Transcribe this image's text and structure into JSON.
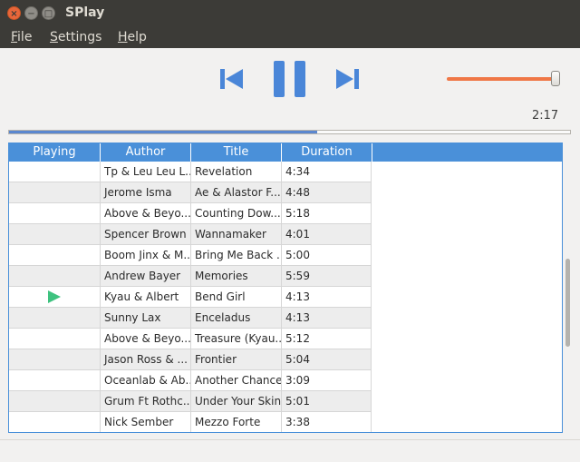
{
  "window": {
    "title": "SPlay",
    "close_glyph": "×",
    "min_glyph": "−",
    "max_glyph": "□"
  },
  "menu": {
    "file": {
      "accel": "F",
      "rest": "ile"
    },
    "settings": {
      "accel": "S",
      "rest": "ettings"
    },
    "help": {
      "accel": "H",
      "rest": "elp"
    }
  },
  "controls": {
    "prev_icon": "skip-previous-icon",
    "pause_icon": "pause-icon",
    "next_icon": "skip-next-icon",
    "accent_color": "#4a86d8"
  },
  "volume": {
    "level": 0.96,
    "track_color": "#f07746"
  },
  "playback": {
    "time": "2:17",
    "progress": 0.55
  },
  "playlist": {
    "columns": [
      "Playing",
      "Author",
      "Title",
      "Duration"
    ],
    "header_color": "#4a90d9",
    "playing_icon": "play-icon",
    "playing_icon_color": "#3ec27f",
    "rows": [
      {
        "author": "Tp & Leu Leu L...",
        "title": "Revelation",
        "duration": "4:34",
        "playing": false
      },
      {
        "author": "Jerome Isma",
        "title": "Ae & Alastor F...",
        "duration": "4:48",
        "playing": false
      },
      {
        "author": "Above & Beyo...",
        "title": "Counting Dow...",
        "duration": "5:18",
        "playing": false
      },
      {
        "author": "Spencer Brown",
        "title": "Wannamaker",
        "duration": "4:01",
        "playing": false
      },
      {
        "author": "Boom Jinx & M...",
        "title": "Bring Me Back ...",
        "duration": "5:00",
        "playing": false
      },
      {
        "author": "Andrew Bayer",
        "title": "Memories",
        "duration": "5:59",
        "playing": false
      },
      {
        "author": "Kyau & Albert",
        "title": "Bend Girl",
        "duration": "4:13",
        "playing": true
      },
      {
        "author": "Sunny Lax",
        "title": "Enceladus",
        "duration": "4:13",
        "playing": false
      },
      {
        "author": "Above & Beyo...",
        "title": "Treasure (Kyau...",
        "duration": "5:12",
        "playing": false
      },
      {
        "author": "Jason Ross & ...",
        "title": "Frontier",
        "duration": "5:04",
        "playing": false
      },
      {
        "author": "Oceanlab & Ab...",
        "title": "Another Chance",
        "duration": "3:09",
        "playing": false
      },
      {
        "author": "Grum Ft Rothc...",
        "title": "Under Your Skin",
        "duration": "5:01",
        "playing": false
      },
      {
        "author": "Nick Sember",
        "title": "Mezzo Forte",
        "duration": "3:38",
        "playing": false
      }
    ]
  }
}
